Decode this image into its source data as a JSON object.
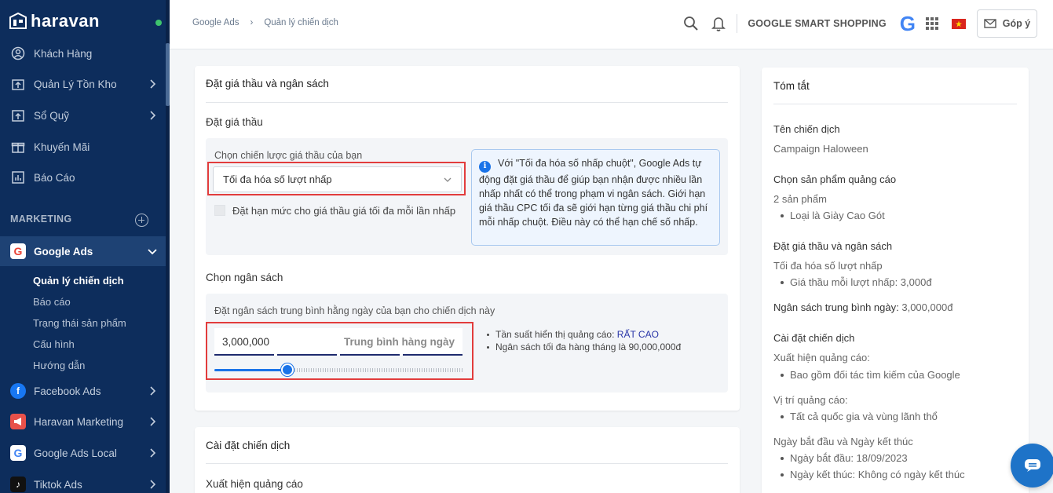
{
  "sidebar": {
    "brand": "haravan",
    "items": [
      {
        "label": "Khách Hàng",
        "icon": "user-circle-icon"
      },
      {
        "label": "Quản Lý Tồn Kho",
        "icon": "inventory-box-icon"
      },
      {
        "label": "Sổ Quỹ",
        "icon": "cashbook-icon"
      },
      {
        "label": "Khuyến Mãi",
        "icon": "gift-icon"
      },
      {
        "label": "Báo Cáo",
        "icon": "report-chart-icon"
      }
    ],
    "section": "MARKETING",
    "active_app": "Google Ads",
    "sub_items": [
      "Quản lý chiến dịch",
      "Báo cáo",
      "Trạng thái sản phẩm",
      "Cấu hình",
      "Hướng dẫn"
    ],
    "apps": [
      "Facebook Ads",
      "Haravan Marketing",
      "Google Ads Local",
      "Tiktok Ads"
    ]
  },
  "header": {
    "breadcrumb": [
      "Google Ads",
      "Quản lý chiến dịch"
    ],
    "shop_label": "GOOGLE SMART SHOPPING",
    "feedback_label": "Góp ý"
  },
  "bidding": {
    "card_title": "Đặt giá thầu và ngân sách",
    "bid_section": "Đặt giá thầu",
    "strategy_label": "Chọn chiến lược giá thầu của bạn",
    "strategy_value": "Tối đa hóa số lượt nhấp",
    "checkbox_label": "Đặt hạn mức cho giá thầu giá tối đa mỗi lần nhấp",
    "info_text": "Với \"Tối đa hóa số nhấp chuột\", Google Ads tự động đặt giá thầu để giúp bạn nhận được nhiều lần nhấp nhất có thể trong phạm vi ngân sách. Giới hạn giá thầu CPC tối đa sẽ giới hạn từng giá thầu chi phí mỗi nhấp chuột. Điều này có thể hạn chế số nhấp.",
    "budget_section": "Chọn ngân sách",
    "budget_label": "Đặt ngân sách trung bình hằng ngày của bạn cho chiến dịch này",
    "budget_value": "3,000,000",
    "budget_unit": "Trung bình hàng ngày",
    "budget_slider_fraction": 0.29,
    "freq_label": "Tần suất hiển thị quảng cáo:",
    "freq_value": "RẤT CAO",
    "monthly_text": "Ngân sách tối đa hàng tháng là 90,000,000đ"
  },
  "campaign": {
    "card_title": "Cài đặt chiến dịch",
    "appearance_label": "Xuất hiện quảng cáo"
  },
  "summary": {
    "title": "Tóm tắt",
    "name_head": "Tên chiến dịch",
    "name_value": "Campaign Haloween",
    "products_head": "Chọn sản phẩm quảng cáo",
    "products_count": "2 sản phẩm",
    "products_item": "Loại là Giày Cao Gót",
    "bid_head": "Đặt giá thầu và ngân sách",
    "bid_strategy": "Tối đa hóa số lượt nhấp",
    "bid_item": "Giá thầu mỗi lượt nhấp: 3,000đ",
    "daily_budget_head": "Ngân sách trung bình ngày:",
    "daily_budget_value": "3,000,000đ",
    "settings_head": "Cài đặt chiến dịch",
    "appearance_head": "Xuất hiện quảng cáo:",
    "appearance_item": "Bao gồm đối tác tìm kiếm của Google",
    "location_head": "Vị trí quảng cáo:",
    "location_item": "Tất cả quốc gia và vùng lãnh thổ",
    "dates_head": "Ngày bắt đầu và Ngày kết thúc",
    "start_item": "Ngày bắt đầu: 18/09/2023",
    "end_item": "Ngày kết thúc: Không có ngày kết thúc"
  }
}
